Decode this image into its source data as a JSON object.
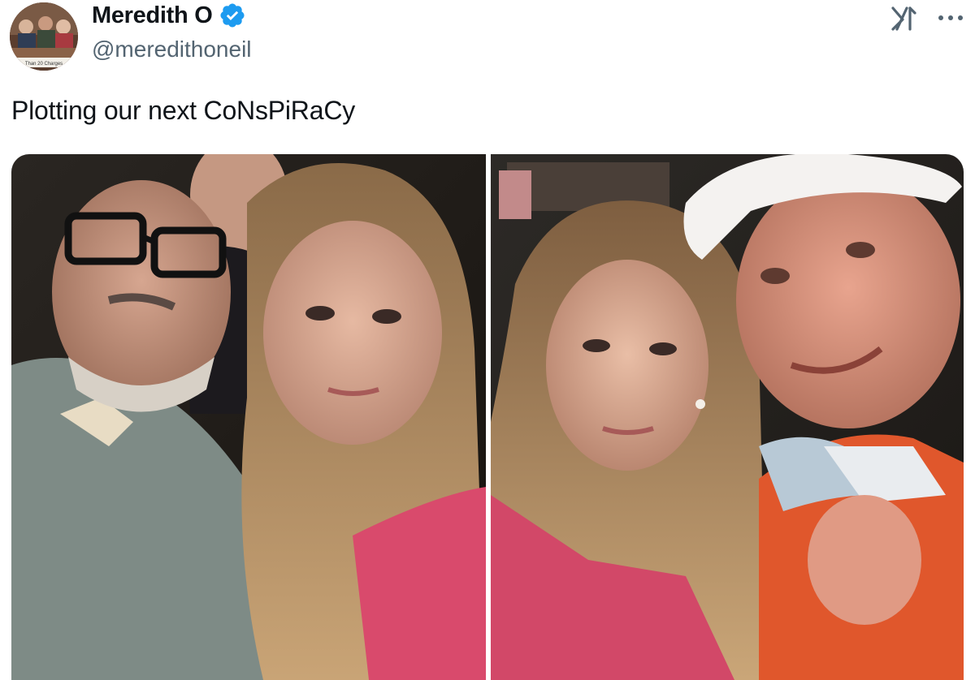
{
  "tweet": {
    "author": {
      "name": "Meredith O",
      "handle": "@meredithoneil",
      "verified": true,
      "avatar_banner_text": "Than 20 Charges"
    },
    "text": "Plotting our next CoNsPiRaCy",
    "media_count": 2
  },
  "header_icons": [
    "x-grok-icon",
    "more-icon"
  ],
  "colors": {
    "verified_blue": "#1d9bf0",
    "handle_gray": "#536471",
    "text": "#0f1419"
  }
}
